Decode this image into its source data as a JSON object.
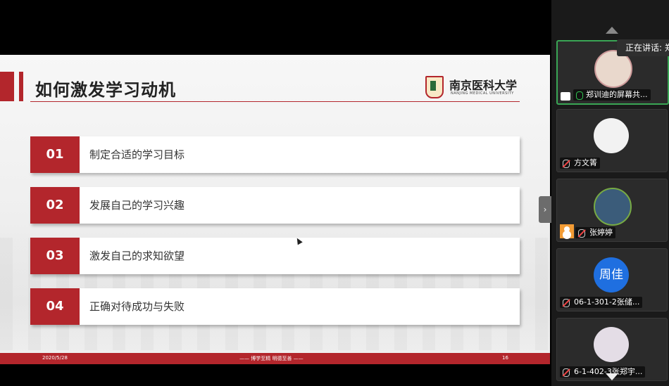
{
  "slide": {
    "title": "如何激发学习动机",
    "logo_cn": "南京医科大学",
    "logo_en": "NANJING MEDICAL UNIVERSITY",
    "items": [
      {
        "num": "01",
        "text": "制定合适的学习目标"
      },
      {
        "num": "02",
        "text": "发展自己的学习兴趣"
      },
      {
        "num": "03",
        "text": "激发自己的求知欲望"
      },
      {
        "num": "04",
        "text": "正确对待成功与失败"
      }
    ],
    "footer": {
      "date": "2020/5/28",
      "motto": "—— 博学至精  明德至善 ——",
      "page": "16"
    },
    "accent_color": "#b3262c"
  },
  "participants": {
    "speaking_label": "正在讲话: 郑",
    "tiles": [
      {
        "name": "郑训迪的屏幕共...",
        "mic": "on",
        "avatar": "cartoon-girl-avatar"
      },
      {
        "name": "方文箐",
        "mic": "off",
        "avatar": "default-person-avatar"
      },
      {
        "name": "张婷婷",
        "mic": "off",
        "avatar": "cartoon-boy-avatar"
      },
      {
        "name": "06-1-301-2张储...",
        "mic": "off",
        "avatar_text": "周佳"
      },
      {
        "name": "6-1-402-3张郑宇...",
        "mic": "off",
        "avatar": "anime-girl-avatar"
      }
    ]
  },
  "icons": {
    "expand": "chevron-right-icon",
    "scroll_up": "triangle-up-icon",
    "scroll_down": "triangle-down-icon"
  }
}
